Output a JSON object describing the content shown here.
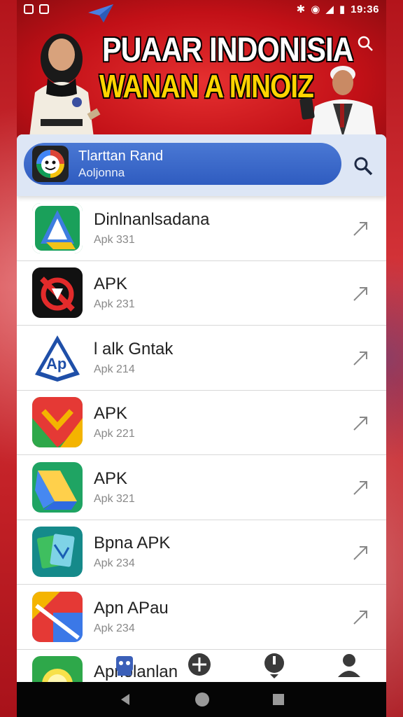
{
  "status_bar": {
    "time": "19:36"
  },
  "banner": {
    "title": "PUAAR INDONISIA",
    "subtitle": "WANAN A MNOIZ"
  },
  "header": {
    "title": "Tlarttan Rand",
    "subtitle": "Aoljonna"
  },
  "apps": [
    {
      "name": "Dinlnanlsadana",
      "sub": "Apk 331",
      "icon": "blue-green-triangle-logo"
    },
    {
      "name": "APK",
      "sub": "Apk 231",
      "icon": "red-x-logo"
    },
    {
      "name": "l alk Gntak",
      "sub": "Apk 214",
      "icon": "blue-ap-logo"
    },
    {
      "name": "APK",
      "sub": "Apk 221",
      "icon": "colorful-m-logo"
    },
    {
      "name": "APK",
      "sub": "Apk 321",
      "icon": "drive-style-logo"
    },
    {
      "name": "Bpna APK",
      "sub": "Apk 234",
      "icon": "green-cards-logo"
    },
    {
      "name": "Apn APau",
      "sub": "Apk 234",
      "icon": "maps-style-logo"
    }
  ],
  "last_row": {
    "name": "Apnolanlan"
  },
  "colors": {
    "banner_red": "#c21017",
    "header_blue": "#2f5cc0",
    "title_yellow": "#ffd400"
  }
}
